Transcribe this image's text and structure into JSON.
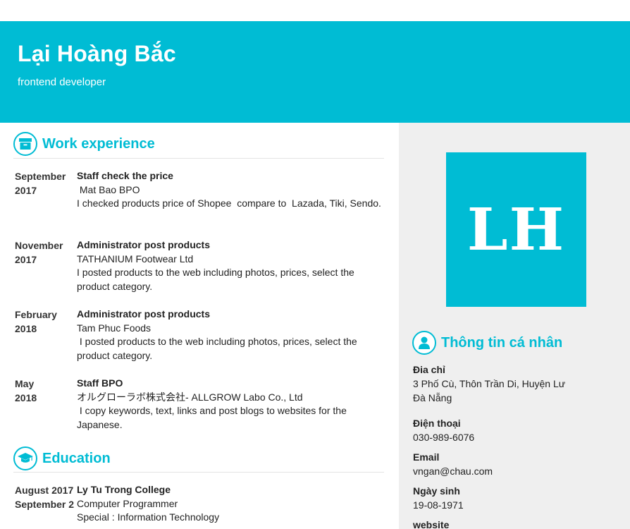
{
  "header": {
    "name": "Lại Hoàng Bắc",
    "job_title": "frontend developer",
    "accent_color": "#00bcd4"
  },
  "work": {
    "title": "Work experience",
    "icon": "archive-box-icon",
    "entries": [
      {
        "date_line1": "September",
        "date_line2": "2017",
        "role": "Staff check the price",
        "company": " Mat Bao BPO",
        "description": "I checked products price of Shopee  compare to  Lazada, Tiki, Sendo."
      },
      {
        "date_line1": "November",
        "date_line2": "2017",
        "role": "Administrator post products",
        "company": "TATHANIUM Footwear Ltd",
        "description": "I posted products to the web including photos, prices, select the product category."
      },
      {
        "date_line1": "February",
        "date_line2": "2018",
        "role": "Administrator post products",
        "company": "Tam Phuc Foods",
        "description": " I posted products to the web including photos, prices, select the product category."
      },
      {
        "date_line1": "May",
        "date_line2": "2018",
        "role": "Staff BPO",
        "company": "オルグローラボ株式会社- ALLGROW Labo Co., Ltd",
        "description": " I copy keywords, text, links and post blogs to websites for the Japanese."
      }
    ]
  },
  "education": {
    "title": "Education",
    "icon": "graduation-cap-icon",
    "entries": [
      {
        "date_line1": "August 2017",
        "date_line2": "September 2",
        "school": "Ly Tu Trong College",
        "program": "Computer Programmer",
        "special": "Special : Information Technology"
      }
    ]
  },
  "avatar": {
    "initials": "LH"
  },
  "personal": {
    "title": "Thông tin cá nhân",
    "icon": "user-icon",
    "address_label": "Đia chỉ",
    "address_line1": "3 Phố Cù, Thôn Trần Di, Huyện Lư",
    "address_line2": "Đà Nẵng",
    "phone_label": "Điện thoại",
    "phone": "030-989-6076",
    "email_label": "Email",
    "email": "vngan@chau.com",
    "birthday_label": "Ngày sinh",
    "birthday": "19-08-1971",
    "website_label": "website"
  }
}
